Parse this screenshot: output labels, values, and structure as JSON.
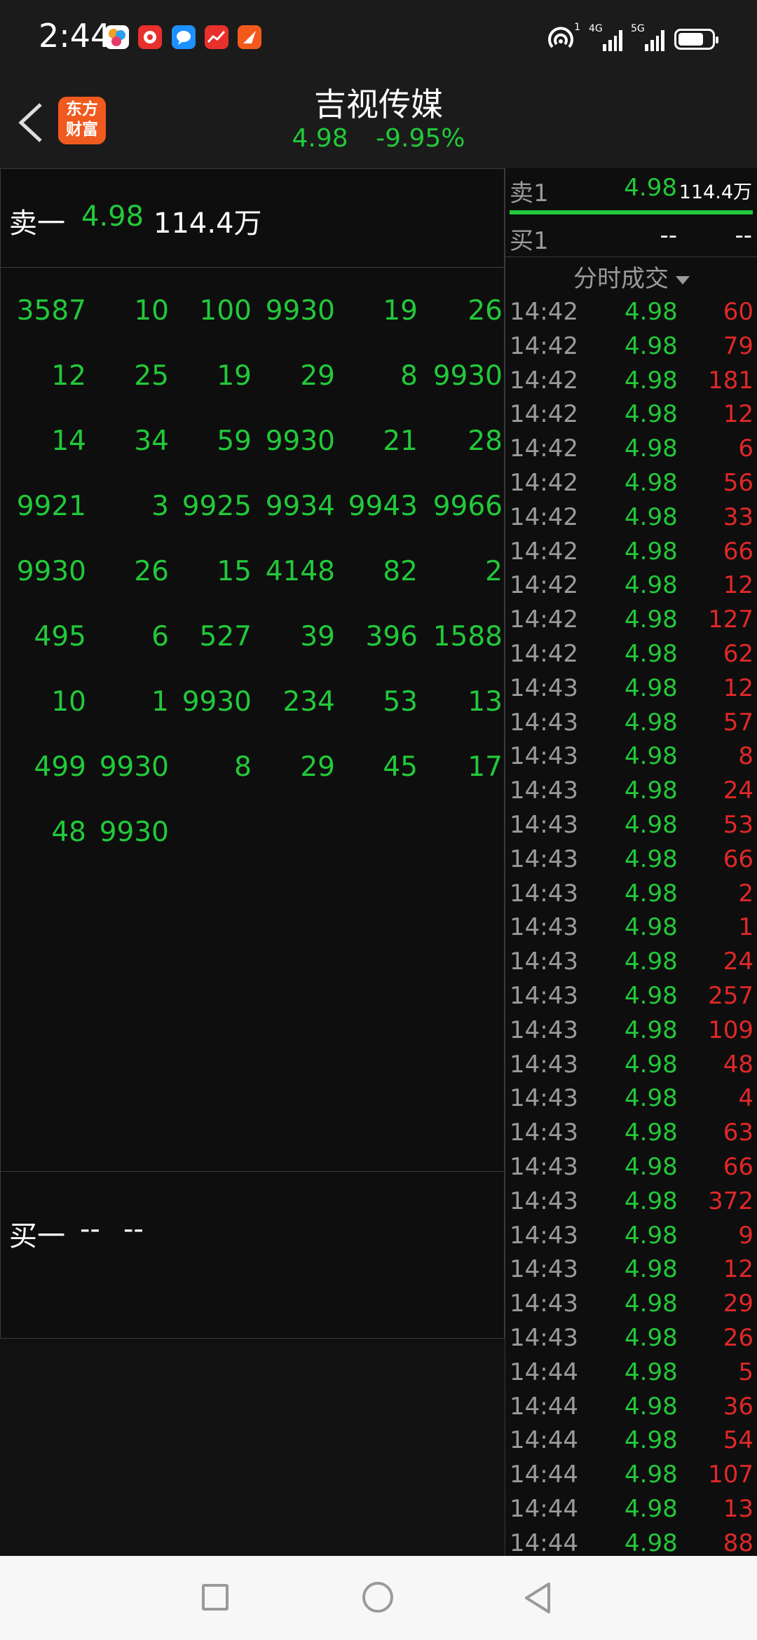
{
  "status_bar": {
    "time": "2:44",
    "notification_icons": [
      "app-icon",
      "app-icon",
      "message-icon",
      "app-icon",
      "app-icon"
    ],
    "signal1_label": "4G",
    "signal2_label": "5G",
    "hotspot_badge": "1",
    "battery_level": 0.75
  },
  "header": {
    "back_icon": "chevron-left-icon",
    "app_logo_line1": "东方",
    "app_logo_line2": "财富",
    "title": "吉视传媒",
    "price": "4.98",
    "change_pct": "-9.95%"
  },
  "sell_row": {
    "label": "卖一",
    "price": "4.98",
    "volume": "114.4万"
  },
  "queue": [
    [
      "3587",
      "10",
      "100",
      "9930",
      "19",
      "26"
    ],
    [
      "12",
      "25",
      "19",
      "29",
      "8",
      "9930"
    ],
    [
      "14",
      "34",
      "59",
      "9930",
      "21",
      "28"
    ],
    [
      "9921",
      "3",
      "9925",
      "9934",
      "9943",
      "9966"
    ],
    [
      "9930",
      "26",
      "15",
      "4148",
      "82",
      "2"
    ],
    [
      "495",
      "6",
      "527",
      "39",
      "396",
      "1588"
    ],
    [
      "10",
      "1",
      "9930",
      "234",
      "53",
      "13"
    ],
    [
      "499",
      "9930",
      "8",
      "29",
      "45",
      "17"
    ],
    [
      "48",
      "9930"
    ]
  ],
  "buy_row": {
    "label": "买一",
    "price": "--",
    "volume": "--"
  },
  "order_book": {
    "sell1": {
      "label": "卖1",
      "price": "4.98",
      "volume": "114.4万"
    },
    "buy1": {
      "label": "买1",
      "price": "--",
      "volume": "--"
    }
  },
  "trades_header": "分时成交",
  "trades": [
    {
      "time": "14:42",
      "price": "4.98",
      "vol": "60"
    },
    {
      "time": "14:42",
      "price": "4.98",
      "vol": "79"
    },
    {
      "time": "14:42",
      "price": "4.98",
      "vol": "181"
    },
    {
      "time": "14:42",
      "price": "4.98",
      "vol": "12"
    },
    {
      "time": "14:42",
      "price": "4.98",
      "vol": "6"
    },
    {
      "time": "14:42",
      "price": "4.98",
      "vol": "56"
    },
    {
      "time": "14:42",
      "price": "4.98",
      "vol": "33"
    },
    {
      "time": "14:42",
      "price": "4.98",
      "vol": "66"
    },
    {
      "time": "14:42",
      "price": "4.98",
      "vol": "12"
    },
    {
      "time": "14:42",
      "price": "4.98",
      "vol": "127"
    },
    {
      "time": "14:42",
      "price": "4.98",
      "vol": "62"
    },
    {
      "time": "14:43",
      "price": "4.98",
      "vol": "12"
    },
    {
      "time": "14:43",
      "price": "4.98",
      "vol": "57"
    },
    {
      "time": "14:43",
      "price": "4.98",
      "vol": "8"
    },
    {
      "time": "14:43",
      "price": "4.98",
      "vol": "24"
    },
    {
      "time": "14:43",
      "price": "4.98",
      "vol": "53"
    },
    {
      "time": "14:43",
      "price": "4.98",
      "vol": "66"
    },
    {
      "time": "14:43",
      "price": "4.98",
      "vol": "2"
    },
    {
      "time": "14:43",
      "price": "4.98",
      "vol": "1"
    },
    {
      "time": "14:43",
      "price": "4.98",
      "vol": "24"
    },
    {
      "time": "14:43",
      "price": "4.98",
      "vol": "257"
    },
    {
      "time": "14:43",
      "price": "4.98",
      "vol": "109"
    },
    {
      "time": "14:43",
      "price": "4.98",
      "vol": "48"
    },
    {
      "time": "14:43",
      "price": "4.98",
      "vol": "4"
    },
    {
      "time": "14:43",
      "price": "4.98",
      "vol": "63"
    },
    {
      "time": "14:43",
      "price": "4.98",
      "vol": "66"
    },
    {
      "time": "14:43",
      "price": "4.98",
      "vol": "372"
    },
    {
      "time": "14:43",
      "price": "4.98",
      "vol": "9"
    },
    {
      "time": "14:43",
      "price": "4.98",
      "vol": "12"
    },
    {
      "time": "14:43",
      "price": "4.98",
      "vol": "29"
    },
    {
      "time": "14:43",
      "price": "4.98",
      "vol": "26"
    },
    {
      "time": "14:44",
      "price": "4.98",
      "vol": "5"
    },
    {
      "time": "14:44",
      "price": "4.98",
      "vol": "36"
    },
    {
      "time": "14:44",
      "price": "4.98",
      "vol": "54"
    },
    {
      "time": "14:44",
      "price": "4.98",
      "vol": "107"
    },
    {
      "time": "14:44",
      "price": "4.98",
      "vol": "13"
    },
    {
      "time": "14:44",
      "price": "4.98",
      "vol": "88"
    }
  ],
  "nav_bar": {
    "recent_icon": "square-icon",
    "home_icon": "circle-icon",
    "back_icon": "triangle-back-icon"
  },
  "colors": {
    "up_green": "#22c93a",
    "down_red": "#e02828",
    "background": "#111111",
    "logo_orange": "#f05a1e"
  }
}
